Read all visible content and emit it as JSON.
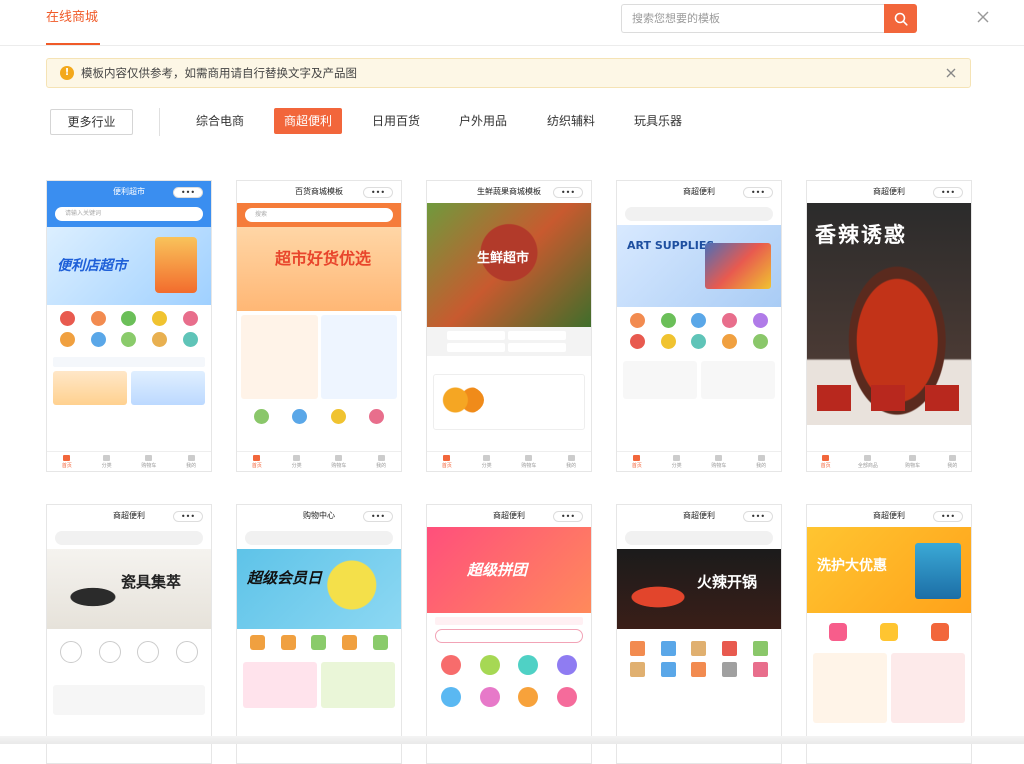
{
  "header": {
    "brand": "在线商城",
    "search_placeholder": "搜索您想要的模板"
  },
  "notice": {
    "text": "模板内容仅供参考，如需商用请自行替换文字及产品图"
  },
  "categories": {
    "more_label": "更多行业",
    "tabs": [
      {
        "label": "综合电商",
        "active": false
      },
      {
        "label": "商超便利",
        "active": true
      },
      {
        "label": "日用百货",
        "active": false
      },
      {
        "label": "户外用品",
        "active": false
      },
      {
        "label": "纺织辅料",
        "active": false
      },
      {
        "label": "玩具乐器",
        "active": false
      }
    ]
  },
  "templates": [
    {
      "bar_title": "便利超市",
      "hero_text": "便利店超市",
      "search": "请输入关键词",
      "nav": [
        "首页",
        "分类",
        "购物车",
        "我的"
      ]
    },
    {
      "bar_title": "百货商城模板",
      "hero_text": "超市好货优选",
      "search": "搜索",
      "nav": [
        "首页",
        "分类",
        "购物车",
        "我的"
      ]
    },
    {
      "bar_title": "生鲜蔬果商城模板",
      "hero_text": "生鲜超市",
      "search": "",
      "nav": [
        "首页",
        "分类",
        "购物车",
        "我的"
      ]
    },
    {
      "bar_title": "商超便利",
      "hero_text": "ART SUPPLIES",
      "search": "",
      "nav": [
        "首页",
        "分类",
        "购物车",
        "我的"
      ]
    },
    {
      "bar_title": "商超便利",
      "hero_text": "香辣诱惑",
      "search": "",
      "nav": [
        "首页",
        "全部商品",
        "购物车",
        "我的"
      ]
    },
    {
      "bar_title": "商超便利",
      "hero_text": "瓷具集萃",
      "search": "",
      "nav": []
    },
    {
      "bar_title": "购物中心",
      "hero_text": "超级会员日",
      "search": "",
      "nav": []
    },
    {
      "bar_title": "商超便利",
      "hero_text": "超级拼团",
      "search": "",
      "nav": []
    },
    {
      "bar_title": "商超便利",
      "hero_text": "火辣开锅",
      "search": "",
      "nav": []
    },
    {
      "bar_title": "商超便利",
      "hero_text": "洗护大优惠",
      "search": "",
      "nav": []
    }
  ],
  "colors": {
    "accent": "#f2663b",
    "notice_bg": "#fdf7e6",
    "notice_icon": "#f3a81b"
  }
}
